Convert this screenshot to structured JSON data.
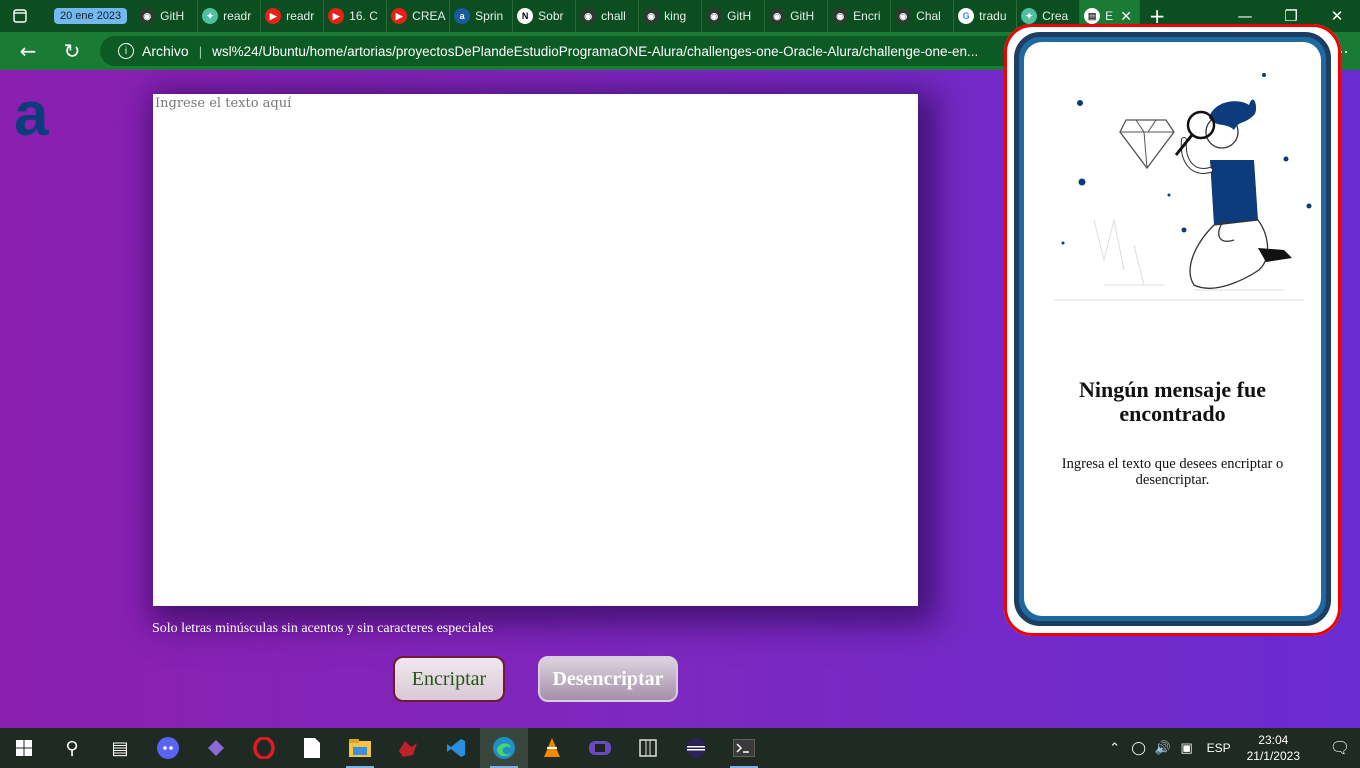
{
  "browser": {
    "date_chip": "20 ene 2023",
    "tabs": [
      {
        "label": "GitH",
        "icon": "github-icon"
      },
      {
        "label": "readr",
        "icon": "chatgpt-icon"
      },
      {
        "label": "readr",
        "icon": "youtube-icon"
      },
      {
        "label": "16. C",
        "icon": "youtube-icon"
      },
      {
        "label": "CREA",
        "icon": "youtube-icon"
      },
      {
        "label": "Sprin",
        "icon": "alura-icon"
      },
      {
        "label": "Sobr",
        "icon": "notion-icon"
      },
      {
        "label": "chall",
        "icon": "github-icon"
      },
      {
        "label": "king",
        "icon": "github-icon"
      },
      {
        "label": "GitH",
        "icon": "github-icon"
      },
      {
        "label": "GitH",
        "icon": "github-icon"
      },
      {
        "label": "Encri",
        "icon": "github-icon"
      },
      {
        "label": "Chal",
        "icon": "github-icon"
      },
      {
        "label": "tradu",
        "icon": "google-icon"
      },
      {
        "label": "Crea",
        "icon": "chatgpt-icon"
      },
      {
        "label": "E",
        "icon": "page-icon",
        "active": true
      }
    ],
    "address": {
      "scheme": "Archivo",
      "url": "wsl%24/Ubuntu/home/artorias/proyectosDePlandeEstudioProgramaONE-Alura/challenges-one-Oracle-Alura/challenge-one-en..."
    }
  },
  "page": {
    "logo": "a",
    "textarea_placeholder": "Ingrese el texto aquí",
    "hint": "Solo letras minúsculas sin acentos y sin caracteres especiales",
    "encrypt_label": "Encriptar",
    "decrypt_label": "Desencriptar",
    "card_title": "Ningún mensaje fue encontrado",
    "card_text": "Ingresa el texto que desees encriptar o desencriptar."
  },
  "taskbar": {
    "lang": "ESP",
    "time": "23:04",
    "date": "21/1/2023"
  },
  "colors": {
    "tabbar": "#0b4f20",
    "addressbar": "#1a7b35",
    "page_start": "#8b1fb0",
    "page_end": "#6a2bd0",
    "logo": "#0d3c7d",
    "card_border": "#1e3d63"
  }
}
